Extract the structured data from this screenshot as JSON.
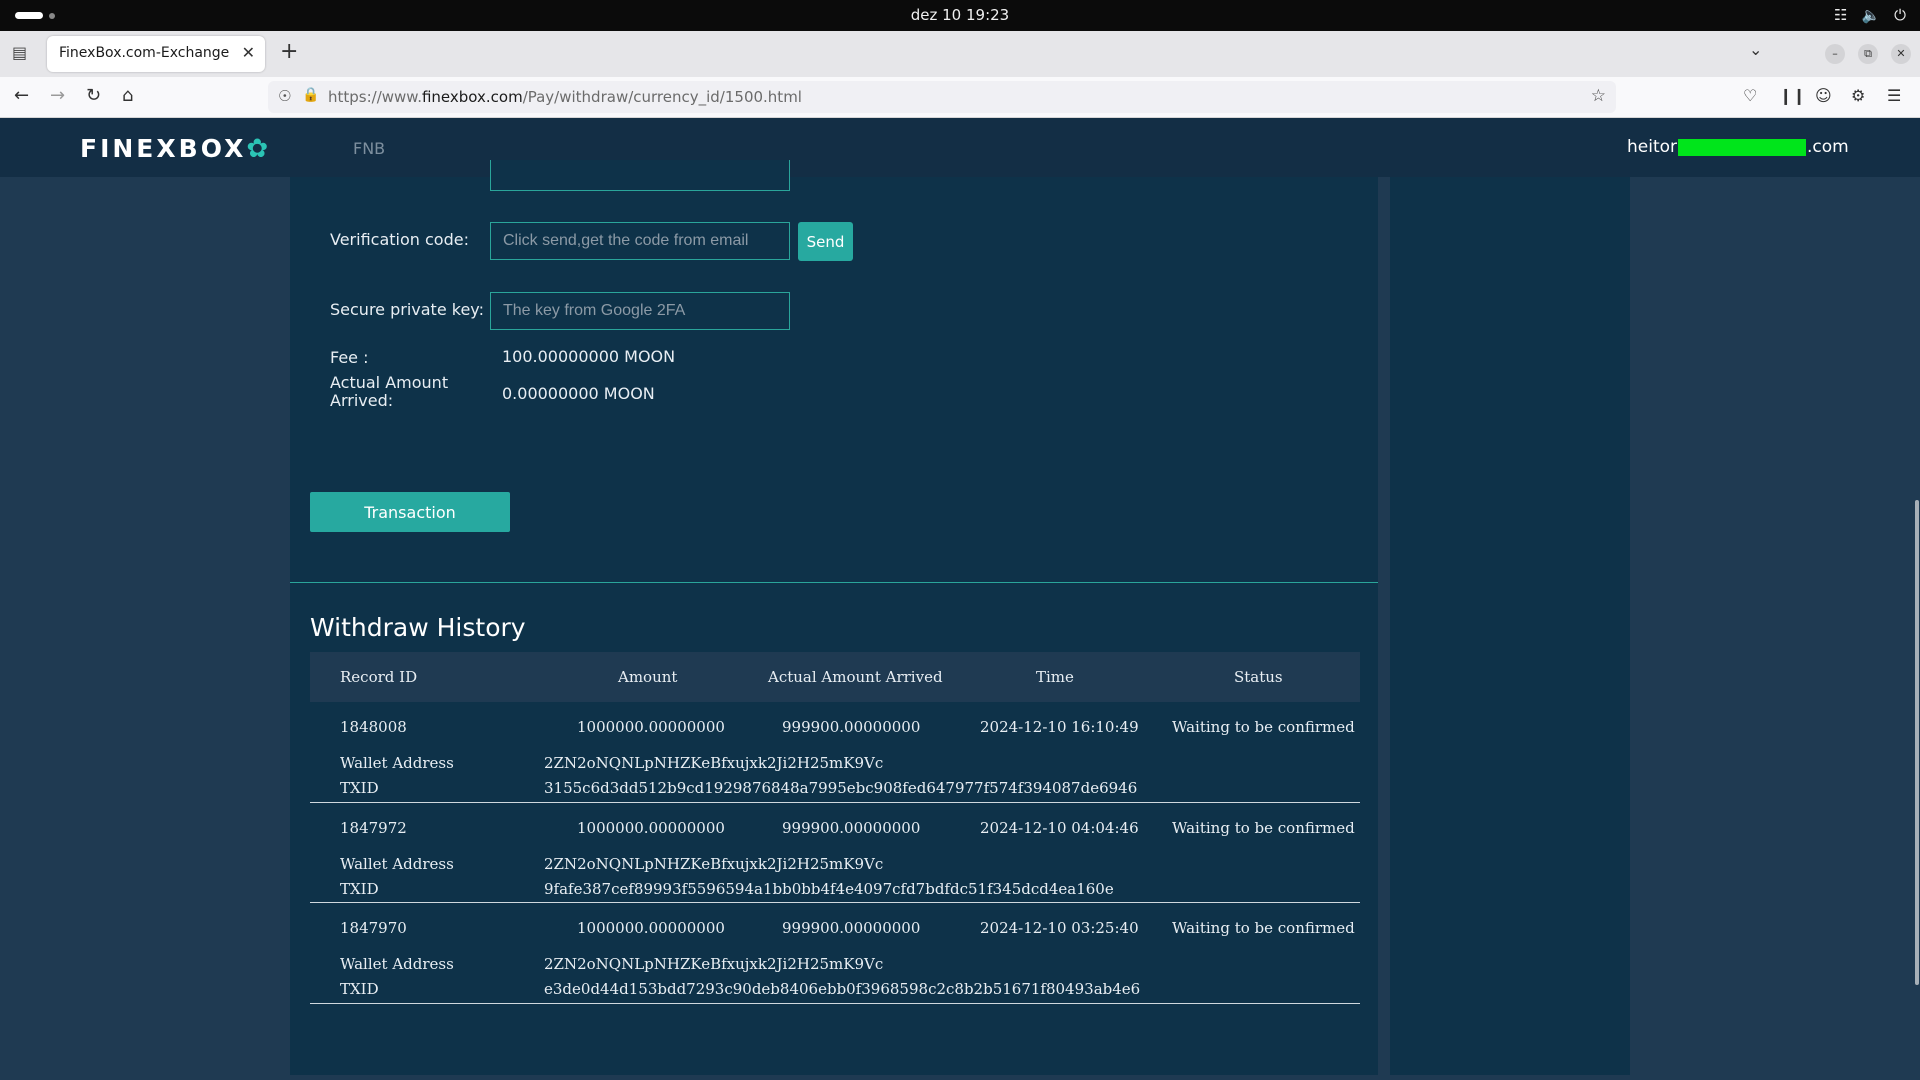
{
  "system": {
    "clock": "dez 10  19:23"
  },
  "browser": {
    "tab_title": "FinexBox.com-Exchange list",
    "url_prefix": "https://www.",
    "url_host": "finexbox.com",
    "url_path": "/Pay/withdraw/currency_id/1500.html"
  },
  "site": {
    "logo": "FINEXBOX",
    "nav_item": "FNB",
    "email_prefix": "heitor",
    "email_suffix": ".com"
  },
  "form": {
    "verification_label": "Verification code:",
    "verification_placeholder": "Click send,get the code from email",
    "send_label": "Send",
    "secure_key_label": "Secure private key:",
    "secure_key_placeholder": "The key from Google 2FA",
    "fee_label": "Fee :",
    "fee_value": "100.00000000 MOON",
    "actual_label_line1": "Actual Amount",
    "actual_label_line2": "Arrived:",
    "actual_value": "0.00000000 MOON",
    "transaction_label": "Transaction"
  },
  "history": {
    "title": "Withdraw History",
    "columns": [
      "Record ID",
      "Amount",
      "Actual Amount Arrived",
      "Time",
      "Status"
    ],
    "wallet_label": "Wallet Address",
    "txid_label": "TXID",
    "rows": [
      {
        "id": "1848008",
        "amount": "1000000.00000000",
        "arrived": "999900.00000000",
        "time": "2024-12-10 16:10:49",
        "status": "Waiting to be confirmed",
        "wallet": "2ZN2oNQNLpNHZKeBfxujxk2Ji2H25mK9Vc",
        "txid": "3155c6d3dd512b9cd1929876848a7995ebc908fed647977f574f394087de6946"
      },
      {
        "id": "1847972",
        "amount": "1000000.00000000",
        "arrived": "999900.00000000",
        "time": "2024-12-10 04:04:46",
        "status": "Waiting to be confirmed",
        "wallet": "2ZN2oNQNLpNHZKeBfxujxk2Ji2H25mK9Vc",
        "txid": "9fafe387cef89993f5596594a1bb0bb4f4e4097cfd7bdfdc51f345dcd4ea160e"
      },
      {
        "id": "1847970",
        "amount": "1000000.00000000",
        "arrived": "999900.00000000",
        "time": "2024-12-10 03:25:40",
        "status": "Waiting to be confirmed",
        "wallet": "2ZN2oNQNLpNHZKeBfxujxk2Ji2H25mK9Vc",
        "txid": "e3de0d44d153bdd7293c90deb8406ebb0f3968598c2c8b2b51671f80493ab4e6"
      }
    ]
  },
  "icons": {
    "tab_close": "close-icon",
    "new_tab": "plus-icon",
    "back": "arrow-left-icon",
    "forward": "arrow-right-icon",
    "reload": "reload-icon",
    "home": "home-icon",
    "bookmark": "star-icon"
  },
  "colors": {
    "header_bg": "#132e45",
    "panel_bg": "#0e3249",
    "accent": "#27a9a0",
    "redaction": "#00e51b"
  }
}
